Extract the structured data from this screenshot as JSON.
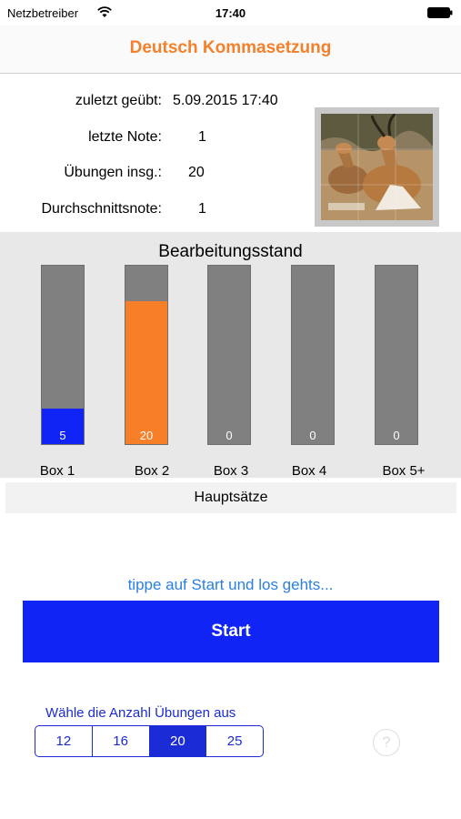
{
  "status": {
    "carrier": "Netzbetreiber",
    "time": "17:40"
  },
  "nav": {
    "title": "Deutsch Kommasetzung"
  },
  "stats": [
    {
      "label": "zuletzt geübt:",
      "value": "5.09.2015 17:40"
    },
    {
      "label": "letzte Note:",
      "value": "1"
    },
    {
      "label": "Übungen insg.:",
      "value": "20"
    },
    {
      "label": "Durchschnittsnote:",
      "value": "1"
    }
  ],
  "progress": {
    "title": "Bearbeitungsstand",
    "boxes": [
      {
        "label": "Box 1",
        "count": "5",
        "fill": 0.2,
        "color": "#0f24f5"
      },
      {
        "label": "Box 2",
        "count": "20",
        "fill": 0.8,
        "color": "#f77f27"
      },
      {
        "label": "Box 3",
        "count": "0",
        "fill": 0,
        "color": "#808080"
      },
      {
        "label": "Box 4",
        "count": "0",
        "fill": 0,
        "color": "#808080"
      },
      {
        "label": "Box 5+",
        "count": "0",
        "fill": 0,
        "color": "#808080"
      }
    ]
  },
  "category": "Hauptsätze",
  "hint": "tippe auf Start und los gehts...",
  "start_label": "Start",
  "count_selector": {
    "caption": "Wähle die Anzahl Übungen aus",
    "options": [
      "12",
      "16",
      "20",
      "25"
    ],
    "selected": "20"
  },
  "help_symbol": "?",
  "colors": {
    "accent": "#f3812b",
    "primary_blue": "#0f24f5",
    "link_blue": "#2a7fe0"
  },
  "icons": {
    "wifi": "wifi-icon",
    "battery": "battery-icon",
    "help": "help-icon",
    "photo": "gazelle-photo"
  }
}
